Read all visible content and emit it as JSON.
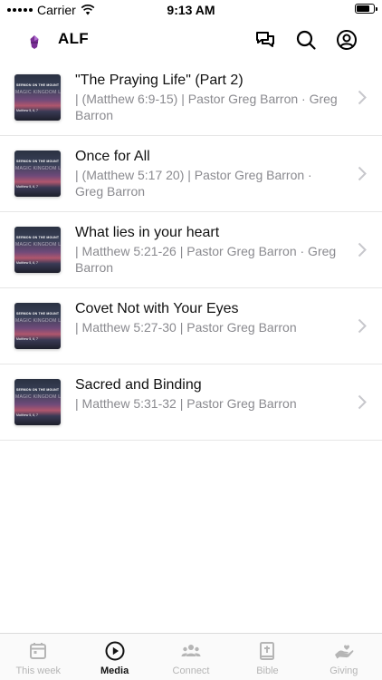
{
  "status_bar": {
    "carrier": "Carrier",
    "time": "9:13 AM"
  },
  "header": {
    "title": "ALF"
  },
  "thumbnail": {
    "top_text": "SERMON ON THE MOUNT",
    "mid_text": "MAGIC KINGDOM LIFE",
    "bottom_text": "Matthew 5, 6, 7"
  },
  "sermons": [
    {
      "title": "\"The Praying Life\" (Part 2)",
      "subtitle": "| (Matthew 6:9-15) | Pastor Greg Barron · Greg Barron"
    },
    {
      "title": "Once for All",
      "subtitle": "| (Matthew  5:17 20) |  Pastor Greg Barron · Greg Barron"
    },
    {
      "title": "What lies in your heart",
      "subtitle": "| Matthew  5:21-26 | Pastor Greg Barron · Greg Barron"
    },
    {
      "title": "Covet Not with Your Eyes",
      "subtitle": "| Matthew  5:27-30 | Pastor Greg Barron"
    },
    {
      "title": "Sacred and Binding",
      "subtitle": "| Matthew  5:31-32 | Pastor Greg Barron"
    }
  ],
  "tabs": [
    {
      "label": "This week",
      "icon": "calendar-icon",
      "active": false
    },
    {
      "label": "Media",
      "icon": "play-icon",
      "active": true
    },
    {
      "label": "Connect",
      "icon": "people-icon",
      "active": false
    },
    {
      "label": "Bible",
      "icon": "bible-icon",
      "active": false
    },
    {
      "label": "Giving",
      "icon": "giving-hand-icon",
      "active": false
    }
  ],
  "colors": {
    "accent": "#6b2d8f",
    "active_tab": "#111111",
    "inactive_tab": "#b5b5b5",
    "subtitle": "#8a8a8f"
  },
  "battery_level": 0.9
}
